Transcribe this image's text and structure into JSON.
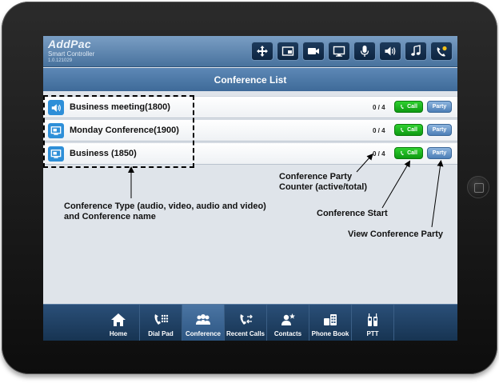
{
  "brand": {
    "name": "AddPac",
    "subtitle": "Smart Controller",
    "version": "1.0.121029"
  },
  "toolbar": {
    "icons": [
      "move-icon",
      "presentation-icon",
      "camera-icon",
      "monitor-icon",
      "microphone-icon",
      "speaker-icon",
      "music-icon",
      "call-status-icon"
    ]
  },
  "title_bar": {
    "title": "Conference List"
  },
  "conferences": [
    {
      "type": "audio",
      "name": "Business meeting(1800)",
      "count": "0 / 4",
      "call_label": "Call",
      "party_label": "Party"
    },
    {
      "type": "video",
      "name": "Monday Conference(1900)",
      "count": "0 / 4",
      "call_label": "Call",
      "party_label": "Party"
    },
    {
      "type": "video",
      "name": "Business (1850)",
      "count": "0 / 4",
      "call_label": "Call",
      "party_label": "Party"
    }
  ],
  "annotations": {
    "party_counter_line1": "Conference Party",
    "party_counter_line2": "Counter (active/total)",
    "type_line1": "Conference Type (audio, video, audio and video)",
    "type_line2": "and Conference name",
    "start": "Conference Start",
    "view_party": "View Conference Party"
  },
  "bottom_nav": {
    "items": [
      {
        "label": "Home",
        "icon": "home-icon"
      },
      {
        "label": "Dial Pad",
        "icon": "dialpad-icon"
      },
      {
        "label": "Conference",
        "icon": "conference-icon",
        "active": true
      },
      {
        "label": "Recent Calls",
        "icon": "recent-calls-icon"
      },
      {
        "label": "Contacts",
        "icon": "contacts-icon"
      },
      {
        "label": "Phone Book",
        "icon": "phonebook-icon"
      },
      {
        "label": "PTT",
        "icon": "ptt-icon"
      }
    ]
  },
  "colors": {
    "header": "#48729d",
    "call_green": "#0e9a12",
    "party_blue": "#4d7fb6",
    "icon_blue": "#2e8fd8"
  }
}
